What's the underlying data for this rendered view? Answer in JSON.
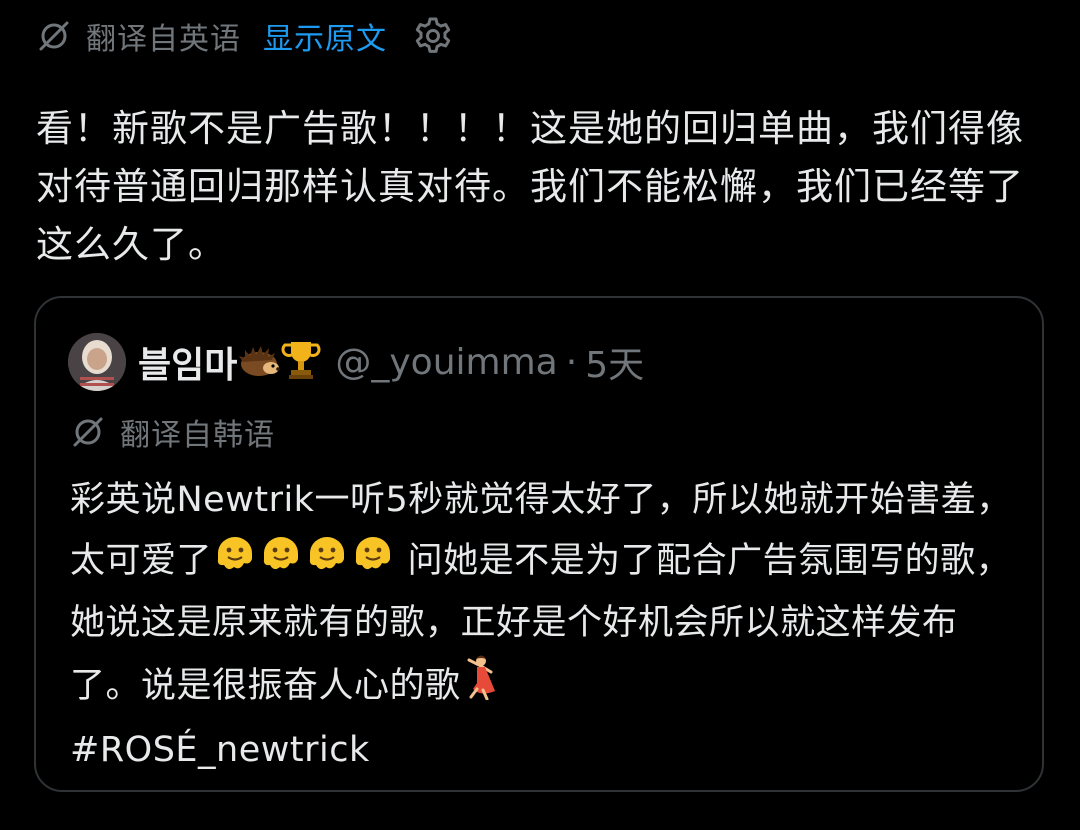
{
  "translation_bar": {
    "label": "翻译自英语",
    "show_original": "显示原文",
    "icon": "translate-off-icon",
    "settings_icon": "gear-icon"
  },
  "post": {
    "text": "看！新歌不是广告歌！！！！这是她的回归单曲，我们得像对待普通回归那样认真对待。我们不能松懈，我们已经等了这么久了。"
  },
  "quote": {
    "author_name": "블임마",
    "author_emojis": [
      "hedgehog-icon",
      "trophy-icon"
    ],
    "handle": "@_youimma",
    "separator": "·",
    "time": "5天",
    "translation_label": "翻译自韩语",
    "body_part1": "彩英说Newtrik一听5秒就觉得太好了，所以她就开始害羞，太可爱了",
    "body_part2": "问她是不是为了配合广告氛围写的歌，她说这是原来就有的歌，正好是个好机会所以就这样发布了。说是很振奋人心的歌",
    "hashtag": "#ROSÉ_newtrick",
    "inline_emojis": [
      "melting-face-icon",
      "melting-face-icon",
      "melting-face-icon",
      "melting-face-icon",
      "dancing-woman-icon"
    ]
  },
  "colors": {
    "background": "#000000",
    "text": "#e7e9ea",
    "secondary": "#71767b",
    "accent": "#1d9bf0",
    "border": "#2f3336"
  }
}
